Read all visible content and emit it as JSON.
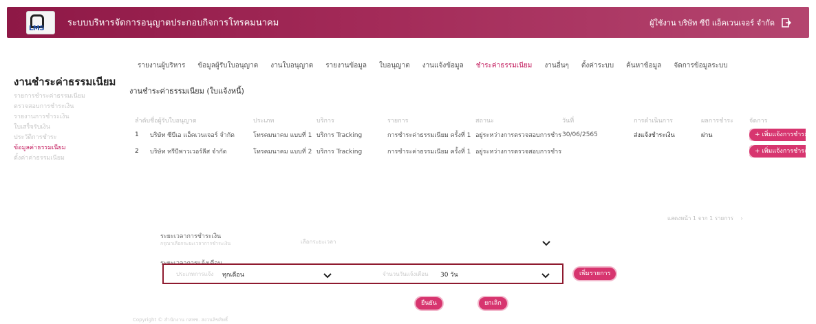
{
  "header": {
    "logo_text": "LMS",
    "title": "ระบบบริหารจัดการอนุญาตประกอบกิจการโทรคมนาคม",
    "user": "ผู้ใช้งาน บริษัท ซีบี แอ็คเวนเจอร์ จำกัด"
  },
  "nav": {
    "items": [
      "รายงานผู้บริหาร",
      "ข้อมูลผู้รับใบอนุญาต",
      "งานใบอนุญาต",
      "รายงานข้อมูล",
      "ใบอนุญาต",
      "งานแจ้งข้อมูล",
      "ชำระค่าธรรมเนียม",
      "งานอื่นๆ",
      "ตั้งค่าระบบ",
      "ค้นหาข้อมูล",
      "จัดการข้อมูลระบบ"
    ],
    "active_index": 6
  },
  "sidebar": {
    "title": "งานชำระค่าธรรมเนียม",
    "items": [
      "รายการชำระค่าธรรมเนียม",
      "ตรวจสอบการชำระเงิน",
      "รายงานการชำระเงิน",
      "ใบเสร็จรับเงิน",
      "ประวัติการชำระ",
      "ข้อมูลค่าธรรมเนียม",
      "ตั้งค่าค่าธรรมเนียม"
    ],
    "active_index": 5
  },
  "section_title": "งานชำระค่าธรรมเนียม (ใบแจ้งหนี้)",
  "table": {
    "headers": [
      "ลำดับ",
      "ชื่อผู้รับใบอนุญาต",
      "ประเภท",
      "บริการ",
      "รายการ",
      "สถานะ",
      "วันที่",
      "การดำเนินการ",
      "ผลการชำระ",
      "จัดการ"
    ],
    "rows": [
      {
        "no": "1",
        "name": "บริษัท ซีบีเอ แอ็คเวนเจอร์ จำกัด",
        "type": "โทรคมนาคม แบบที่ 1",
        "service": "บริการ Tracking",
        "item": "การชำระค่าธรรมเนียม ครั้งที่ 1",
        "status": "อยู่ระหว่างการตรวจสอบการชำระ",
        "date": "30/06/2565",
        "action": "ส่งแจ้งชำระเงิน",
        "result": "ผ่าน",
        "button": "+ เพิ่มแจ้งการชำระ"
      },
      {
        "no": "2",
        "name": "บริษัท ทรีบีพาวเวอร์ลีส จำกัด",
        "type": "โทรคมนาคม แบบที่ 2",
        "service": "บริการ Tracking",
        "item": "การชำระค่าธรรมเนียม ครั้งที่ 1",
        "status": "อยู่ระหว่างการตรวจสอบการชำระ",
        "date": "",
        "action": "",
        "result": "",
        "button": "+ เพิ่มแจ้งการชำระ"
      }
    ]
  },
  "pagination": {
    "text": "แสดงหน้า 1 จาก 1 รายการ"
  },
  "form1": {
    "label": "ระยะเวลาการชำระเงิน",
    "sublabel": "กรุณาเลือกระยะเวลาการชำระเงิน",
    "value": "เลือกระยะเวลา"
  },
  "form2": {
    "label": "ระยะเวลาการแจ้งเตือน",
    "field1_label": "ประเภทการแจ้ง",
    "field1_value": "ทุกเดือน",
    "field2_label": "จำนวนวันแจ้งเตือน",
    "field2_value": "30 วัน"
  },
  "buttons": {
    "add": "เพิ่มรายการ",
    "confirm": "ยืนยัน",
    "cancel": "ยกเลิก"
  },
  "footer": "Copyright © สำนักงาน กสทช. สงวนลิขสิทธิ์",
  "colors": {
    "brand": "#a32a58",
    "accent": "#d7356f",
    "border": "#8e1a2f"
  }
}
